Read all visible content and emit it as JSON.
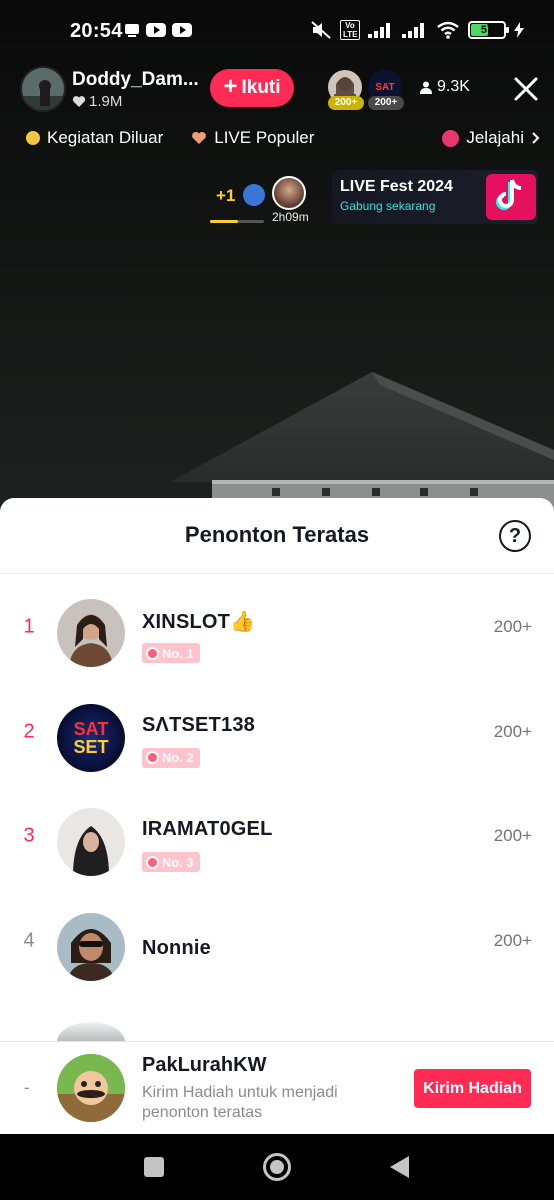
{
  "status_bar": {
    "time": "20:54",
    "battery": "57",
    "volte": "Vo LTE"
  },
  "host": {
    "name": "Doddy_Dam...",
    "likes": "1.9M",
    "follow_label": "Ikuti"
  },
  "top_viewers": [
    {
      "badge": "200+",
      "badge_color": "#c9b400"
    },
    {
      "badge": "200+",
      "badge_color": "#4a4a4a",
      "logo_text": "SAT"
    }
  ],
  "viewer_count": "9.3K",
  "tags": {
    "items": [
      {
        "label": "Kegiatan Diluar",
        "color": "#f5c542"
      },
      {
        "label": "LIVE Populer",
        "color": "#f0a070"
      }
    ],
    "explore_label": "Jelajahi",
    "explore_color": "#e8366f"
  },
  "gift_widget": {
    "plus_one": "+1",
    "progress": 0.52,
    "timer": "2h09m"
  },
  "live_fest": {
    "title": "LIVE Fest 2024",
    "subtitle": "Gabung sekarang"
  },
  "sheet": {
    "title": "Penonton Teratas",
    "help_symbol": "?",
    "ranks": [
      {
        "rank": "1",
        "name": "XINSLOT👍",
        "badge": "No. 1",
        "count": "200+"
      },
      {
        "rank": "2",
        "name": "SΛTSET138",
        "badge": "No. 2",
        "count": "200+",
        "logo_line1": "SAT",
        "logo_line2": "SET"
      },
      {
        "rank": "3",
        "name": "IRAMAT0GEL",
        "badge": "No. 3",
        "count": "200+"
      },
      {
        "rank": "4",
        "name": "Nonnie",
        "count": "200+"
      }
    ],
    "me": {
      "rank": "-",
      "name": "PakLurahKW",
      "hint": "Kirim Hadiah untuk menjadi penonton teratas",
      "send_label": "Kirim Hadiah"
    }
  },
  "colors": {
    "accent": "#fe2c55",
    "rank_top": "#fe2c55",
    "rank_other": "#8a8b91",
    "badge_bg": "#ffc3ce"
  }
}
